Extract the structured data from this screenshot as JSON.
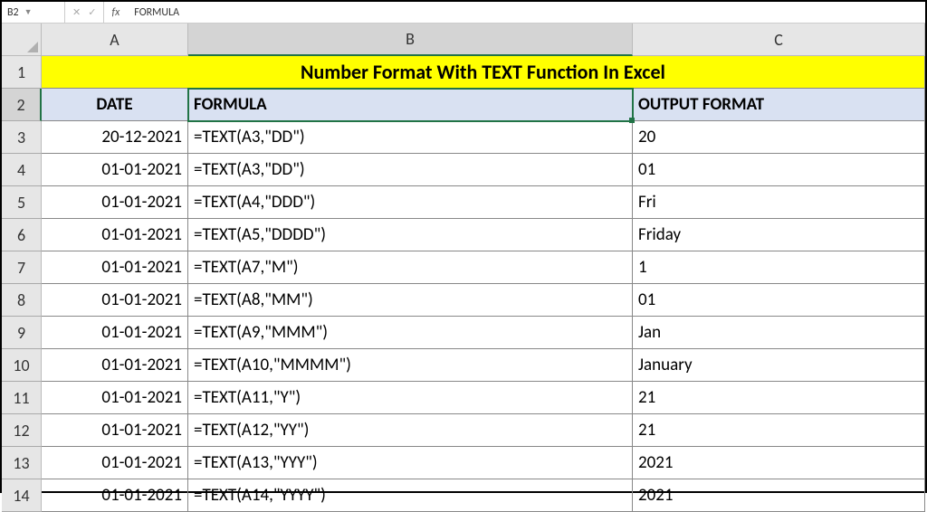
{
  "name_box": "B2",
  "formula_bar": "FORMULA",
  "columns": [
    "A",
    "B",
    "C"
  ],
  "selected_col_index": 1,
  "selected_row_index": 1,
  "title": "Number Format With TEXT Function In Excel",
  "headers": {
    "a": "DATE",
    "b": "FORMULA",
    "c": "OUTPUT FORMAT"
  },
  "rows": [
    {
      "num": "1"
    },
    {
      "num": "2"
    },
    {
      "num": "3",
      "date": "20-12-2021",
      "formula": "=TEXT(A3,\"DD\")",
      "out": "20"
    },
    {
      "num": "4",
      "date": "01-01-2021",
      "formula": "=TEXT(A3,\"DD\")",
      "out": "01"
    },
    {
      "num": "5",
      "date": "01-01-2021",
      "formula": "=TEXT(A4,\"DDD\")",
      "out": "Fri"
    },
    {
      "num": "6",
      "date": "01-01-2021",
      "formula": "=TEXT(A5,\"DDDD\")",
      "out": "Friday"
    },
    {
      "num": "7",
      "date": "01-01-2021",
      "formula": "=TEXT(A7,\"M\")",
      "out": "1"
    },
    {
      "num": "8",
      "date": "01-01-2021",
      "formula": "=TEXT(A8,\"MM\")",
      "out": "01"
    },
    {
      "num": "9",
      "date": "01-01-2021",
      "formula": "=TEXT(A9,\"MMM\")",
      "out": "Jan"
    },
    {
      "num": "10",
      "date": "01-01-2021",
      "formula": "=TEXT(A10,\"MMMM\")",
      "out": "January"
    },
    {
      "num": "11",
      "date": "01-01-2021",
      "formula": "=TEXT(A11,\"Y\")",
      "out": "21"
    },
    {
      "num": "12",
      "date": "01-01-2021",
      "formula": "=TEXT(A12,\"YY\")",
      "out": "21"
    },
    {
      "num": "13",
      "date": "01-01-2021",
      "formula": "=TEXT(A13,\"YYY\")",
      "out": "2021"
    },
    {
      "num": "14",
      "date": "01-01-2021",
      "formula": "=TEXT(A14,\"YYYY\")",
      "out": "2021"
    }
  ]
}
